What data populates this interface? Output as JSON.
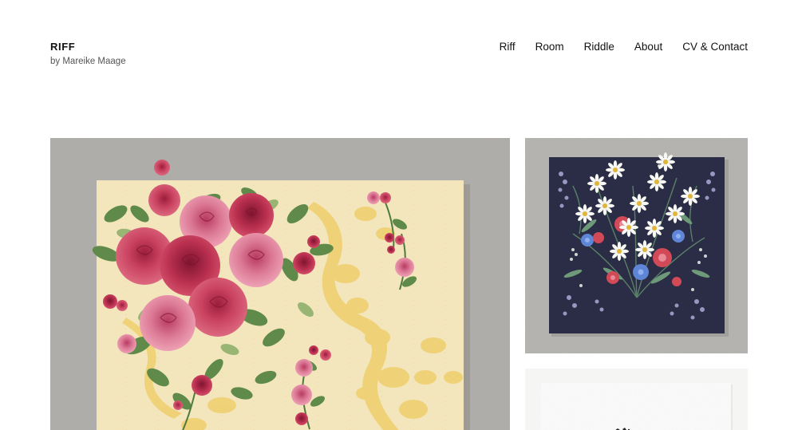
{
  "site": {
    "title": "RIFF",
    "tagline": "by Mareike Maage"
  },
  "nav": {
    "items": [
      {
        "label": "Riff"
      },
      {
        "label": "Room"
      },
      {
        "label": "Riddle"
      },
      {
        "label": "About"
      },
      {
        "label": "CV & Contact"
      }
    ]
  },
  "gallery": {
    "items": [
      {
        "icon": "floral-rose-wallpaper-image"
      },
      {
        "icon": "floral-daisy-wallpaper-image"
      },
      {
        "icon": "white-textured-wallpaper-image"
      }
    ]
  },
  "colors": {
    "background": "#ffffff",
    "text": "#111111",
    "tagline": "#555555"
  }
}
